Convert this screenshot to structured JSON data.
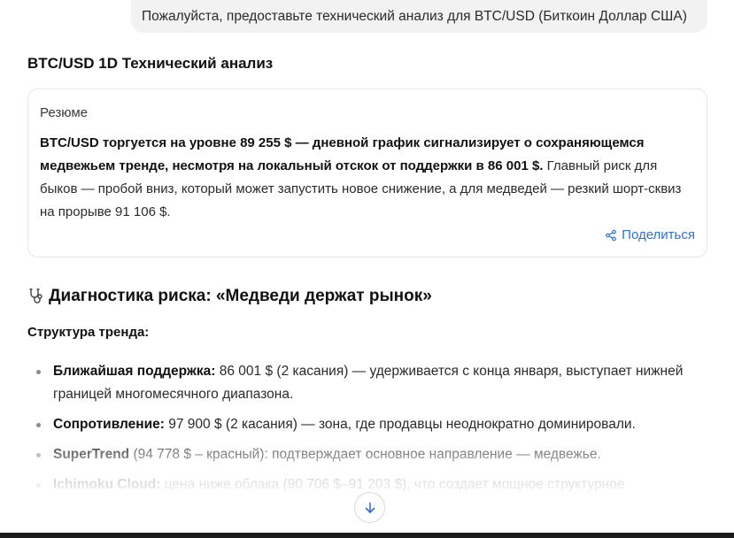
{
  "user_message": "Пожалуйста, предоставьте технический анализ для BTC/USD (Биткоин Доллар США)",
  "analysis_title": "BTC/USD 1D Технический анализ",
  "summary": {
    "label": "Резюме",
    "bold_text": "BTC/USD торгуется на уровне 89 255 $ — дневной график сигнализирует о сохраняющемся медвежьем тренде, несмотря на локальный отскок от поддержки в 86 001 $.",
    "text": " Главный риск для быков — пробой вниз, который может запустить новое снижение, а для медведей — резкий шорт-сквиз на прорыве 91 106 $.",
    "share_label": "Поделиться"
  },
  "risk_heading": "Диагностика риска: «Медведи держат рынок»",
  "trend_label": "Структура тренда:",
  "bullets": [
    {
      "term": "Ближайшая поддержка:",
      "text": " 86 001 $ (2 касания) — удерживается с конца января, выступает нижней границей многомесячного диапазона."
    },
    {
      "term": "Сопротивление:",
      "text": " 97 900 $ (2 касания) — зона, где продавцы неоднократно доминировали."
    },
    {
      "term": "SuperTrend",
      "text": " (94 778 $ – красный): подтверждает основное направление — медвежье."
    },
    {
      "term": "Ichimoku Cloud:",
      "text": " цена ниже облака (90 706 $–91 203 $), что создает мощное структурное"
    }
  ],
  "icons": {
    "share": "share-icon",
    "stethoscope": "stethoscope-icon",
    "scroll_down": "arrow-down-icon"
  },
  "colors": {
    "link": "#2f6fd6",
    "bubble_bg": "#f2f2f2",
    "card_border": "#e6e6e6"
  }
}
